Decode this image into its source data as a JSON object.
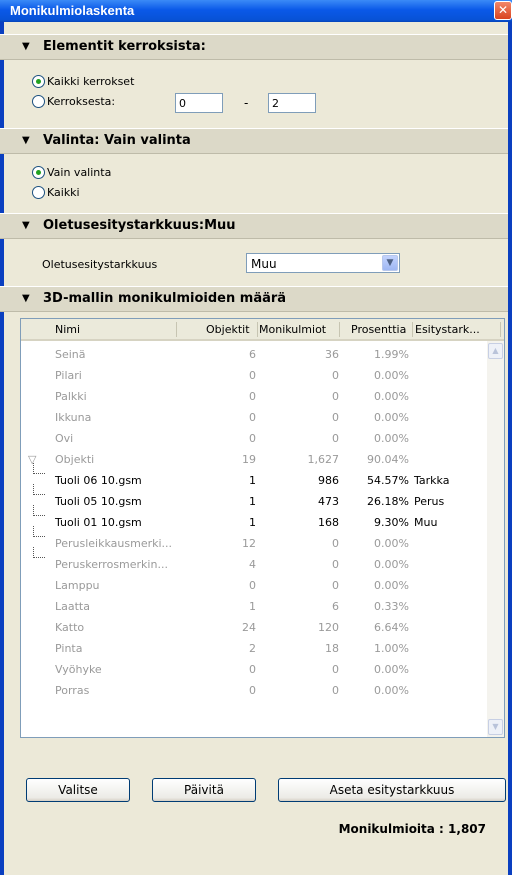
{
  "window": {
    "title": "Monikulmiolaskenta",
    "close_glyph": "✕"
  },
  "sections": {
    "elements": "Elementit kerroksista:",
    "selection": "Valinta: Vain valinta",
    "default_detail": "Oletusesitystarkkuus:Muu",
    "polycount": "3D-mallin monikulmioiden määrä"
  },
  "arrow_glyph": "▼",
  "floors": {
    "all_label": "Kaikki kerrokset",
    "from_label": "Kerroksesta:",
    "from_value": "0",
    "dash": "-",
    "to_value": "2"
  },
  "selection": {
    "only_label": "Vain valinta",
    "all_label": "Kaikki"
  },
  "detail": {
    "label": "Oletusesitystarkkuus",
    "value": "Muu"
  },
  "table": {
    "headers": [
      "Nimi",
      "Objektit",
      "Monikulmiot",
      "Prosenttia",
      "Esitystark..."
    ],
    "rows": [
      {
        "name": "Seinä",
        "objects": "6",
        "polys": "36",
        "pct": "1.99%",
        "detail": "",
        "style": "gray",
        "indent": 0
      },
      {
        "name": "Pilari",
        "objects": "0",
        "polys": "0",
        "pct": "0.00%",
        "detail": "",
        "style": "gray",
        "indent": 0
      },
      {
        "name": "Palkki",
        "objects": "0",
        "polys": "0",
        "pct": "0.00%",
        "detail": "",
        "style": "gray",
        "indent": 0
      },
      {
        "name": "Ikkuna",
        "objects": "0",
        "polys": "0",
        "pct": "0.00%",
        "detail": "",
        "style": "gray",
        "indent": 0
      },
      {
        "name": "Ovi",
        "objects": "0",
        "polys": "0",
        "pct": "0.00%",
        "detail": "",
        "style": "gray",
        "indent": 0
      },
      {
        "name": "Objekti",
        "objects": "19",
        "polys": "1,627",
        "pct": "90.04%",
        "detail": "",
        "style": "gray",
        "indent": 0,
        "expander": "▽"
      },
      {
        "name": "Tuoli 06 10.gsm",
        "objects": "1",
        "polys": "986",
        "pct": "54.57%",
        "detail": "Tarkka",
        "style": "black",
        "indent": 1
      },
      {
        "name": "Tuoli 05 10.gsm",
        "objects": "1",
        "polys": "473",
        "pct": "26.18%",
        "detail": "Perus",
        "style": "black",
        "indent": 1
      },
      {
        "name": "Tuoli 01 10.gsm",
        "objects": "1",
        "polys": "168",
        "pct": "9.30%",
        "detail": "Muu",
        "style": "black",
        "indent": 1
      },
      {
        "name": "Perusleikkausmerki...",
        "objects": "12",
        "polys": "0",
        "pct": "0.00%",
        "detail": "",
        "style": "gray",
        "indent": 1
      },
      {
        "name": "Peruskerrosmerkin...",
        "objects": "4",
        "polys": "0",
        "pct": "0.00%",
        "detail": "",
        "style": "gray",
        "indent": 1
      },
      {
        "name": "Lamppu",
        "objects": "0",
        "polys": "0",
        "pct": "0.00%",
        "detail": "",
        "style": "gray",
        "indent": 0
      },
      {
        "name": "Laatta",
        "objects": "1",
        "polys": "6",
        "pct": "0.33%",
        "detail": "",
        "style": "gray",
        "indent": 0
      },
      {
        "name": "Katto",
        "objects": "24",
        "polys": "120",
        "pct": "6.64%",
        "detail": "",
        "style": "gray",
        "indent": 0
      },
      {
        "name": "Pinta",
        "objects": "2",
        "polys": "18",
        "pct": "1.00%",
        "detail": "",
        "style": "gray",
        "indent": 0
      },
      {
        "name": "Vyöhyke",
        "objects": "0",
        "polys": "0",
        "pct": "0.00%",
        "detail": "",
        "style": "gray",
        "indent": 0
      },
      {
        "name": "Porras",
        "objects": "0",
        "polys": "0",
        "pct": "0.00%",
        "detail": "",
        "style": "gray",
        "indent": 0
      }
    ]
  },
  "buttons": {
    "select": "Valitse",
    "refresh": "Päivitä",
    "set_detail": "Aseta esitystarkkuus"
  },
  "total": "Monikulmioita : 1,807",
  "colors": {
    "title_bar": "#0A59E8",
    "panel": "#ECE9D8",
    "radio_dot": "#21A121"
  }
}
